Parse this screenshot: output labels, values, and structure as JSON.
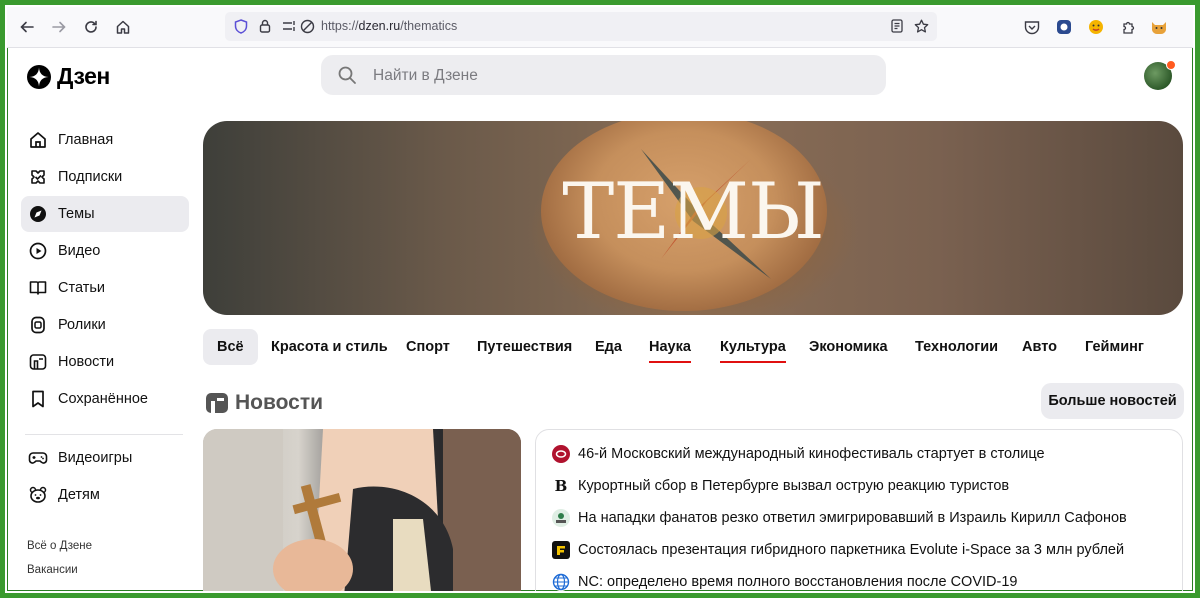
{
  "browser": {
    "url_prefix": "https://",
    "url_domain": "dzen.ru",
    "url_path": "/thematics"
  },
  "header": {
    "logo_text": "Дзен",
    "search_placeholder": "Найти в Дзене"
  },
  "sidebar": {
    "items": [
      {
        "label": "Главная",
        "icon": "home-icon"
      },
      {
        "label": "Подписки",
        "icon": "subscriptions-icon"
      },
      {
        "label": "Темы",
        "icon": "compass-icon"
      },
      {
        "label": "Видео",
        "icon": "video-icon"
      },
      {
        "label": "Статьи",
        "icon": "book-icon"
      },
      {
        "label": "Ролики",
        "icon": "shorts-icon"
      },
      {
        "label": "Новости",
        "icon": "news-icon"
      },
      {
        "label": "Сохранённое",
        "icon": "bookmark-icon"
      },
      {
        "label": "Видеоигры",
        "icon": "gamepad-icon"
      },
      {
        "label": "Детям",
        "icon": "bear-icon"
      }
    ],
    "footer": [
      "Всё о Дзене",
      "Вакансии"
    ]
  },
  "banner": {
    "title": "ТЕМЫ"
  },
  "tabs": [
    {
      "label": "Всё"
    },
    {
      "label": "Красота и стиль"
    },
    {
      "label": "Спорт"
    },
    {
      "label": "Путешествия"
    },
    {
      "label": "Еда"
    },
    {
      "label": "Наука"
    },
    {
      "label": "Культура"
    },
    {
      "label": "Экономика"
    },
    {
      "label": "Технологии"
    },
    {
      "label": "Авто"
    },
    {
      "label": "Гейминг"
    }
  ],
  "news": {
    "title": "Новости",
    "more_label": "Больше новостей",
    "items": [
      {
        "text": "46-й Московский международный кинофестиваль стартует в столице",
        "source_color": "#b0122e"
      },
      {
        "text": "Курортный сбор в Петербурге вызвал острую реакцию туристов",
        "source_color": "#111111"
      },
      {
        "text": "На нападки фанатов резко ответил эмигрировавший в Израиль Кирилл Сафонов",
        "source_color": "#2e7d4a"
      },
      {
        "text": "Состоялась презентация гибридного паркетника Evolute i-Space за 3 млн рублей",
        "source_color": "#f2c200"
      },
      {
        "text": "NC: определено время полного восстановления после COVID-19",
        "source_color": "#1e6bd6"
      }
    ]
  }
}
